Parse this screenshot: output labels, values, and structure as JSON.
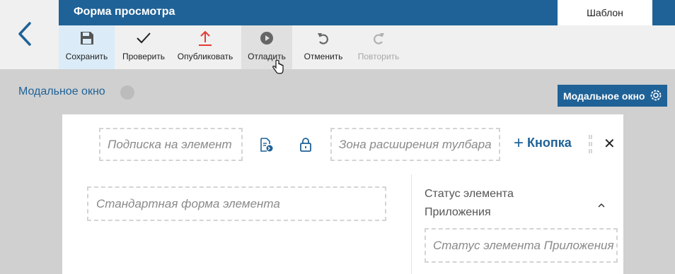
{
  "header": {
    "title": "Форма просмотра",
    "tab_template": "Шаблон"
  },
  "toolbar": {
    "items": [
      {
        "label": "Сохранить",
        "icon": "save-icon",
        "state": "active"
      },
      {
        "label": "Проверить",
        "icon": "check-icon",
        "state": "normal"
      },
      {
        "label": "Опубликовать",
        "icon": "publish-icon",
        "state": "normal"
      },
      {
        "label": "Отладить",
        "icon": "debug-play-icon",
        "state": "hover"
      },
      {
        "label": "Отменить",
        "icon": "undo-icon",
        "state": "normal"
      },
      {
        "label": "Повторить",
        "icon": "redo-icon",
        "state": "disabled"
      }
    ]
  },
  "page": {
    "modal_label": "Модальное окно",
    "modal_button": "Модальное окно"
  },
  "canvas": {
    "subscription_placeholder": "Подписка на элемент",
    "toolbar_zone_placeholder": "Зона расширения тулбара",
    "add_button": "Кнопка",
    "standard_form_placeholder": "Стандартная форма элемента",
    "side_title": "Статус элемента Приложения",
    "status_placeholder": "Статус элемента Приложения"
  },
  "colors": {
    "brand_blue": "#1f6297",
    "publish_red": "#e53935",
    "background": "#d0d0d0"
  }
}
